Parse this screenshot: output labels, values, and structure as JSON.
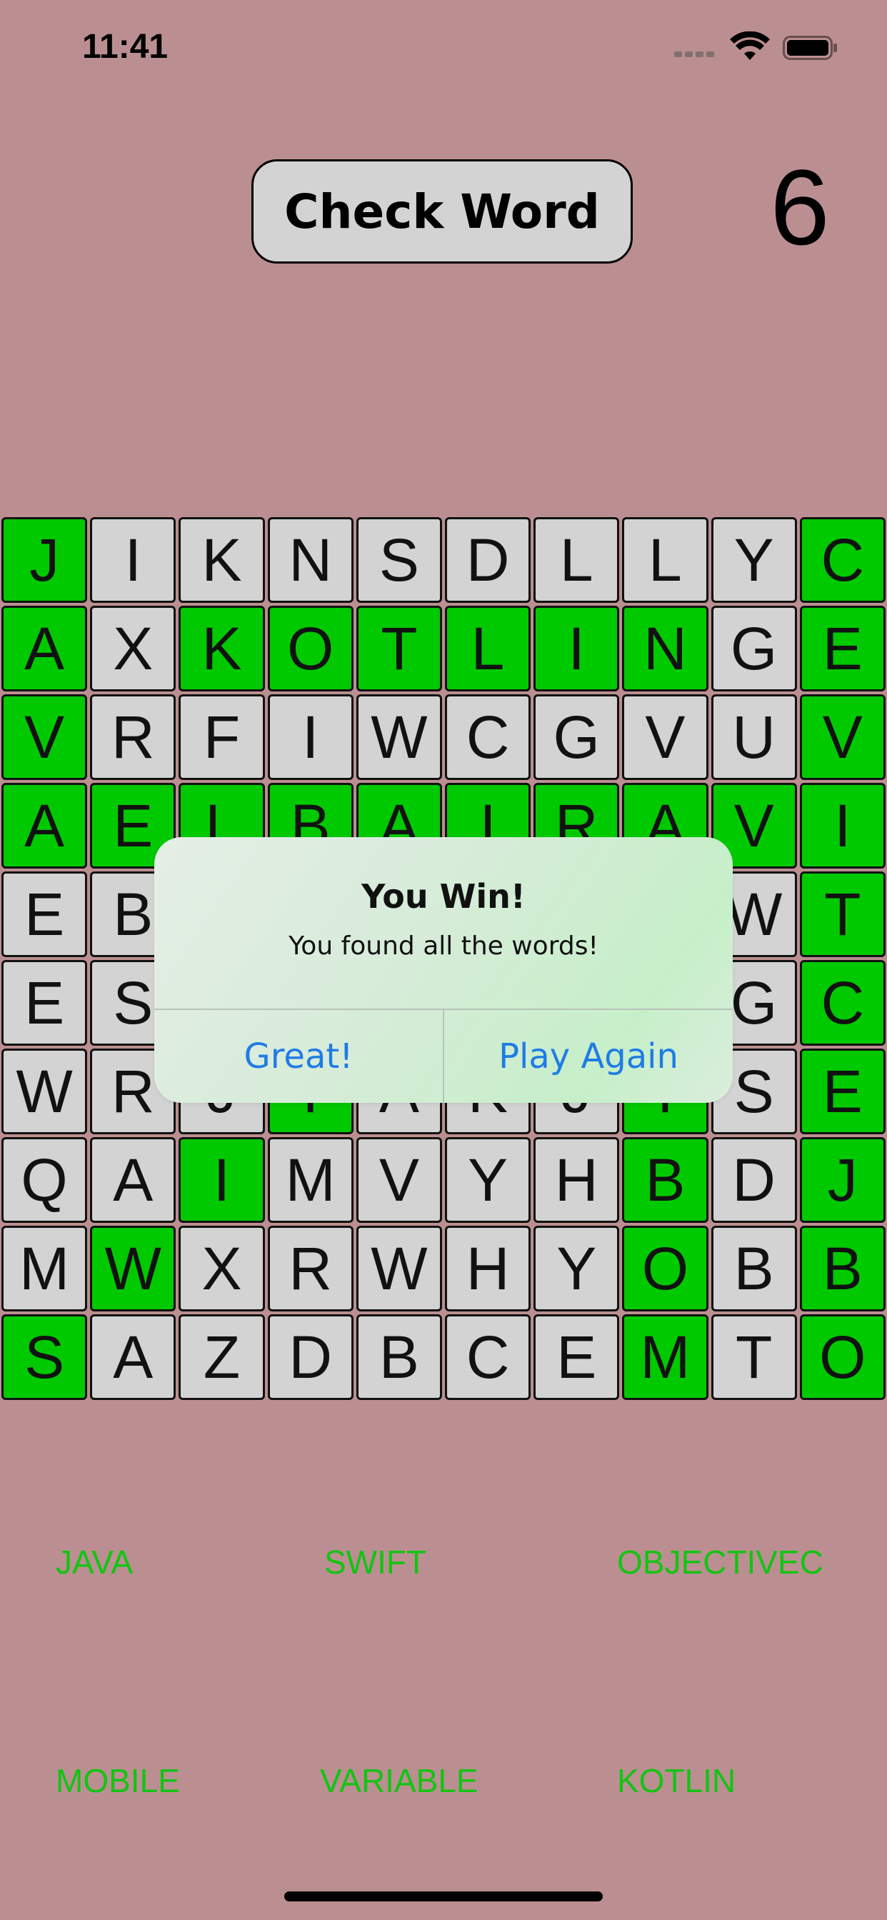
{
  "status_bar": {
    "time": "11:41"
  },
  "header": {
    "check_button_label": "Check Word",
    "score": "6"
  },
  "grid": {
    "rows": [
      [
        "J",
        "I",
        "K",
        "N",
        "S",
        "D",
        "L",
        "L",
        "Y",
        "C"
      ],
      [
        "A",
        "X",
        "K",
        "O",
        "T",
        "L",
        "I",
        "N",
        "G",
        "E"
      ],
      [
        "V",
        "R",
        "F",
        "I",
        "W",
        "C",
        "G",
        "V",
        "U",
        "V"
      ],
      [
        "A",
        "E",
        "L",
        "B",
        "A",
        "I",
        "R",
        "A",
        "V",
        "I"
      ],
      [
        "E",
        "B",
        "",
        "",
        "",
        "",
        "",
        "",
        "W",
        "T"
      ],
      [
        "E",
        "S",
        "",
        "",
        "",
        "",
        "",
        "",
        "G",
        "C"
      ],
      [
        "W",
        "R",
        "J",
        "T",
        "A",
        "K",
        "J",
        "T",
        "S",
        "E"
      ],
      [
        "Q",
        "A",
        "I",
        "M",
        "V",
        "Y",
        "H",
        "B",
        "D",
        "J"
      ],
      [
        "M",
        "W",
        "X",
        "R",
        "W",
        "H",
        "Y",
        "O",
        "B",
        "B"
      ],
      [
        "S",
        "A",
        "Z",
        "D",
        "B",
        "C",
        "E",
        "M",
        "T",
        "O"
      ]
    ],
    "found": [
      [
        1,
        0,
        0,
        0,
        0,
        0,
        0,
        0,
        0,
        1
      ],
      [
        1,
        0,
        1,
        1,
        1,
        1,
        1,
        1,
        0,
        1
      ],
      [
        1,
        0,
        0,
        0,
        0,
        0,
        0,
        0,
        0,
        1
      ],
      [
        1,
        1,
        1,
        1,
        1,
        1,
        1,
        1,
        1,
        1
      ],
      [
        0,
        0,
        0,
        0,
        0,
        0,
        0,
        0,
        0,
        1
      ],
      [
        0,
        0,
        0,
        0,
        0,
        0,
        0,
        0,
        0,
        1
      ],
      [
        0,
        0,
        0,
        1,
        0,
        0,
        0,
        1,
        0,
        1
      ],
      [
        0,
        0,
        1,
        0,
        0,
        0,
        0,
        1,
        0,
        1
      ],
      [
        0,
        1,
        0,
        0,
        0,
        0,
        0,
        1,
        0,
        1
      ],
      [
        1,
        0,
        0,
        0,
        0,
        0,
        0,
        1,
        0,
        1
      ]
    ],
    "found_color": "#00c900",
    "cell_color": "#d3d3d3"
  },
  "word_list": {
    "words": [
      "JAVA",
      "SWIFT",
      "OBJECTIVEC",
      "MOBILE",
      "VARIABLE",
      "KOTLIN"
    ],
    "color": "#12c412"
  },
  "alert": {
    "title": "You Win!",
    "message": "You found all the words!",
    "buttons": [
      "Great!",
      "Play Again"
    ]
  },
  "colors": {
    "background": "#bb8f91",
    "alert_button": "#1f7ce6"
  }
}
